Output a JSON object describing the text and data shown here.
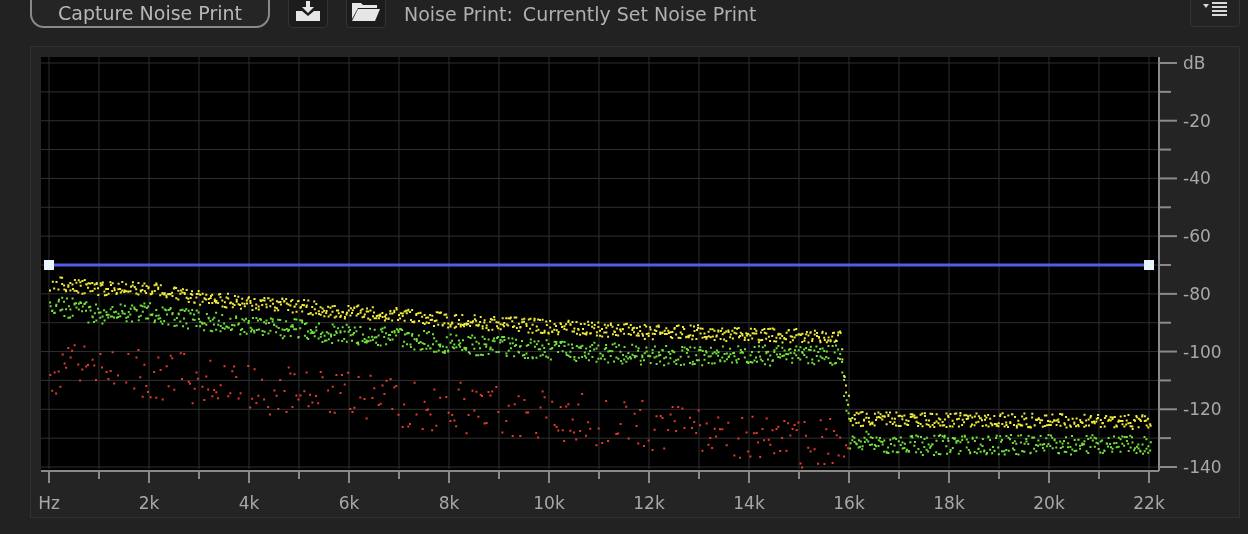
{
  "toolbar": {
    "capture_button": "Capture Noise Print",
    "noise_print_label": "Noise Print:",
    "noise_print_value": "Currently Set Noise Print"
  },
  "spectrum": {
    "chart_data": {
      "type": "line",
      "grid": true,
      "x": [
        0,
        22
      ],
      "series": [
        {
          "color": "#4f5fe6",
          "marker": "square",
          "values": [
            -70,
            -70
          ]
        }
      ],
      "xlim": [
        0,
        22
      ],
      "ylim": [
        -140,
        0
      ],
      "xticks": [
        {
          "value": 0,
          "label": "Hz"
        },
        {
          "value": 2,
          "label": "2k"
        },
        {
          "value": 4,
          "label": "4k"
        },
        {
          "value": 6,
          "label": "6k"
        },
        {
          "value": 8,
          "label": "8k"
        },
        {
          "value": 10,
          "label": "10k"
        },
        {
          "value": 12,
          "label": "12k"
        },
        {
          "value": 14,
          "label": "14k"
        },
        {
          "value": 16,
          "label": "16k"
        },
        {
          "value": 18,
          "label": "18k"
        },
        {
          "value": 20,
          "label": "20k"
        },
        {
          "value": 22,
          "label": "22k"
        }
      ],
      "yticks": [
        {
          "value": 0,
          "label": "dB"
        },
        -20,
        -40,
        -60,
        -80,
        -100,
        -120,
        -140
      ]
    }
  }
}
